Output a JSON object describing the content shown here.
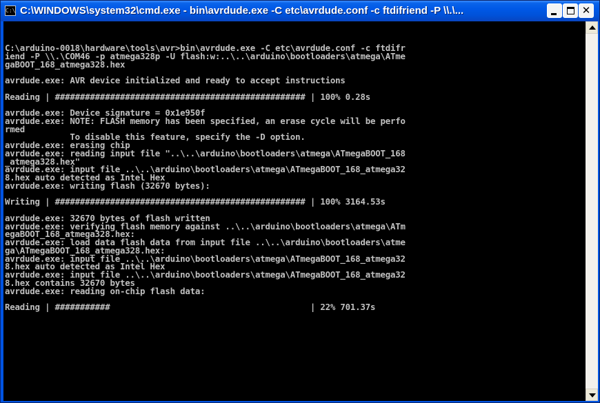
{
  "window": {
    "title": "C:\\WINDOWS\\system32\\cmd.exe - bin\\avrdude.exe -C etc\\avrdude.conf -c ftdifriend -P \\\\.\\...",
    "icon_text": "C:\\",
    "minimize_icon": "minimize-icon",
    "maximize_icon": "maximize-icon",
    "close_icon": "close-icon",
    "close_glyph": "✕"
  },
  "colors": {
    "console_bg": "#000000",
    "console_text": "#c0c0c0",
    "titlebar": "#0054e3",
    "title_text": "#ffffff"
  },
  "console": {
    "lines": [
      "C:\\arduino-0018\\hardware\\tools\\avr>bin\\avrdude.exe -C etc\\avrdude.conf -c ftdifr",
      "iend -P \\\\.\\COM46 -p atmega328p -U flash:w:..\\..\\arduino\\bootloaders\\atmega\\ATme",
      "gaBOOT_168_atmega328.hex",
      "",
      "avrdude.exe: AVR device initialized and ready to accept instructions",
      "",
      "Reading | ################################################## | 100% 0.28s",
      "",
      "avrdude.exe: Device signature = 0x1e950f",
      "avrdude.exe: NOTE: FLASH memory has been specified, an erase cycle will be perfo",
      "rmed",
      "             To disable this feature, specify the -D option.",
      "avrdude.exe: erasing chip",
      "avrdude.exe: reading input file \"..\\..\\arduino\\bootloaders\\atmega\\ATmegaBOOT_168",
      "_atmega328.hex\"",
      "avrdude.exe: input file ..\\..\\arduino\\bootloaders\\atmega\\ATmegaBOOT_168_atmega32",
      "8.hex auto detected as Intel Hex",
      "avrdude.exe: writing flash (32670 bytes):",
      "",
      "Writing | ################################################## | 100% 3164.53s",
      "",
      "avrdude.exe: 32670 bytes of flash written",
      "avrdude.exe: verifying flash memory against ..\\..\\arduino\\bootloaders\\atmega\\ATm",
      "egaBOOT_168_atmega328.hex:",
      "avrdude.exe: load data flash data from input file ..\\..\\arduino\\bootloaders\\atme",
      "ga\\ATmegaBOOT_168_atmega328.hex:",
      "avrdude.exe: input file ..\\..\\arduino\\bootloaders\\atmega\\ATmegaBOOT_168_atmega32",
      "8.hex auto detected as Intel Hex",
      "avrdude.exe: input file ..\\..\\arduino\\bootloaders\\atmega\\ATmegaBOOT_168_atmega32",
      "8.hex contains 32670 bytes",
      "avrdude.exe: reading on-chip flash data:",
      "",
      "Reading | ###########                                        | 22% 701.37s"
    ]
  },
  "scrollbar": {
    "up_icon": "scroll-up-arrow-icon",
    "down_icon": "scroll-down-arrow-icon"
  }
}
